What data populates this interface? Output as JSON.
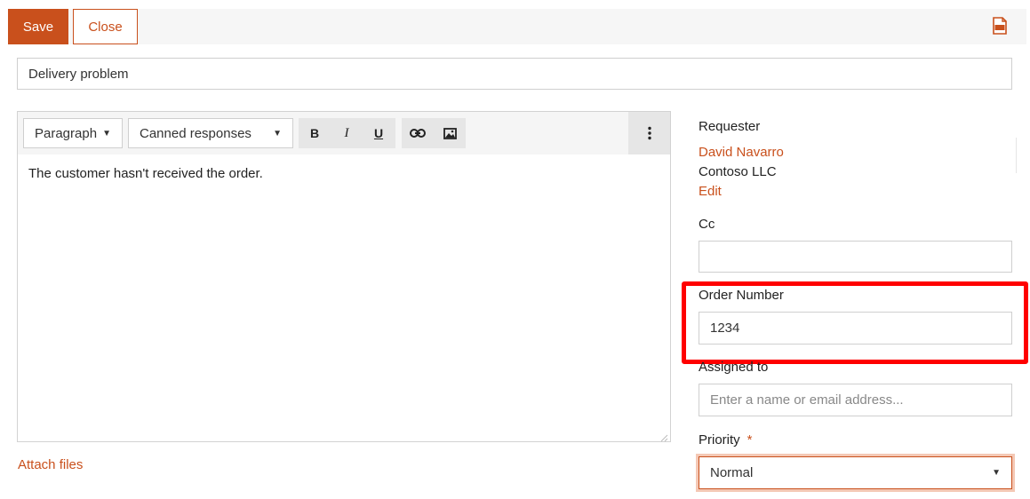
{
  "toolbar": {
    "save_label": "Save",
    "close_label": "Close",
    "pdf_icon": "pdf-icon"
  },
  "subject": {
    "value": "Delivery problem"
  },
  "editor": {
    "paragraph_select": "Paragraph",
    "canned_select": "Canned responses",
    "bold": "B",
    "italic": "I",
    "underline": "U",
    "content": "The customer hasn't received the order."
  },
  "attach_label": "Attach files",
  "requester": {
    "label": "Requester",
    "name": "David Navarro",
    "company": "Contoso LLC",
    "edit_label": "Edit"
  },
  "cc": {
    "label": "Cc",
    "value": ""
  },
  "order_number": {
    "label": "Order Number",
    "value": "1234"
  },
  "assigned_to": {
    "label": "Assigned to",
    "placeholder": "Enter a name or email address..."
  },
  "priority": {
    "label": "Priority",
    "required_mark": "*",
    "value": "Normal"
  },
  "colors": {
    "accent": "#c9501c",
    "highlight": "#ff0000"
  }
}
